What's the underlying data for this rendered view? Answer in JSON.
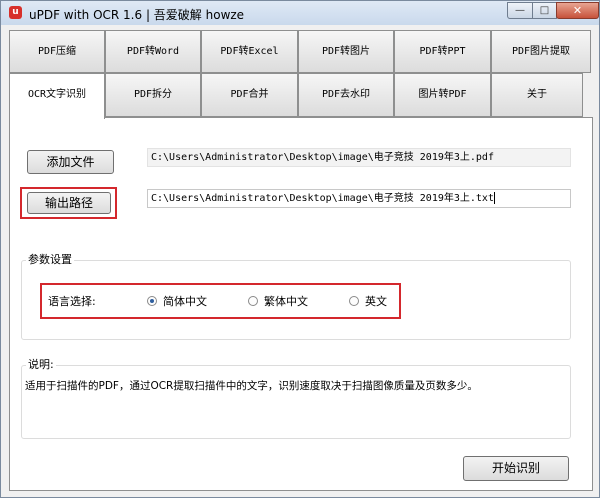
{
  "window": {
    "app_icon_letter": "u",
    "title": "uPDF with OCR 1.6 | 吾爱破解 howze",
    "buttons": {
      "minimize": "—",
      "maximize": "□",
      "close": "✕"
    }
  },
  "tabs_row1": [
    {
      "label": "PDF压缩"
    },
    {
      "label": "PDF转Word"
    },
    {
      "label": "PDF转Excel"
    },
    {
      "label": "PDF转图片"
    },
    {
      "label": "PDF转PPT"
    },
    {
      "label": "PDF图片提取"
    }
  ],
  "tabs_row2": [
    {
      "label": "OCR文字识别",
      "active": true
    },
    {
      "label": "PDF拆分"
    },
    {
      "label": "PDF合并"
    },
    {
      "label": "PDF去水印"
    },
    {
      "label": "图片转PDF"
    },
    {
      "label": "关于"
    }
  ],
  "ocr": {
    "add_file_label": "添加文件",
    "input_path": "C:\\Users\\Administrator\\Desktop\\image\\电子竞技 2019年3上.pdf",
    "output_path_label": "输出路径",
    "output_path": "C:\\Users\\Administrator\\Desktop\\image\\电子竞技 2019年3上.txt",
    "settings_title": "参数设置",
    "language_label": "语言选择:",
    "languages": [
      {
        "label": "简体中文",
        "selected": true
      },
      {
        "label": "繁体中文",
        "selected": false
      },
      {
        "label": "英文",
        "selected": false
      }
    ],
    "description_title": "说明:",
    "description_text": "适用于扫描件的PDF，通过OCR提取扫描件中的文字，识别速度取决于扫描图像质量及页数多少。",
    "start_button_label": "开始识别"
  },
  "colors": {
    "highlight": "#d4282d",
    "active_radio": "#2f5f9f"
  }
}
